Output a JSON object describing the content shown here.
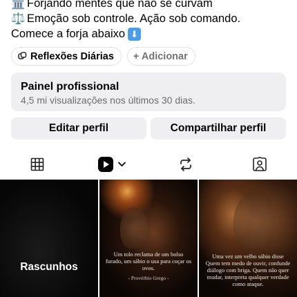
{
  "bio": {
    "lines": [
      {
        "emoji": "🏛️",
        "text": "Forjando mentes que não se curvam"
      },
      {
        "emoji": "⚖️",
        "text": "Emoção sob controle. Ação sob comando."
      },
      {
        "emoji": "",
        "text": "Comece a forja abaixo",
        "trailing_emoji": "⬇️"
      }
    ]
  },
  "chips": {
    "primary_label": "Reflexões Diárias",
    "primary_icon": "threads-icon",
    "secondary_label": "+ Adicionar"
  },
  "panel": {
    "title": "Painel profissional",
    "subtitle": "4,5 mi visualizações nos últimos 30 dias."
  },
  "actions": {
    "edit_label": "Editar perfil",
    "share_label": "Compartilhar perfil"
  },
  "tabs": [
    {
      "icon": "grid-icon",
      "selected": false
    },
    {
      "icon": "reels-icon",
      "selected": true
    },
    {
      "icon": "reposts-icon",
      "selected": false
    },
    {
      "icon": "tagged-icon",
      "selected": false
    }
  ],
  "posts": {
    "drafts_label": "Rascunhos",
    "post1_quote": "Um tolo reclama de um bolso furado, um sábio o usa para coçar os ovos.",
    "post1_author": "- Provérbio Grego -",
    "post2_quote": "Uma vez um velho sábio disse Quem tem medo de ouvir, confunde diálogo com briga. Quem não quer mudar, interpreta qualquer verdade como ataque."
  },
  "colors": {
    "text": "#000000",
    "muted": "#737373",
    "button_bg": "#efeff1",
    "emoji_down_bg": "#4a9de8"
  }
}
